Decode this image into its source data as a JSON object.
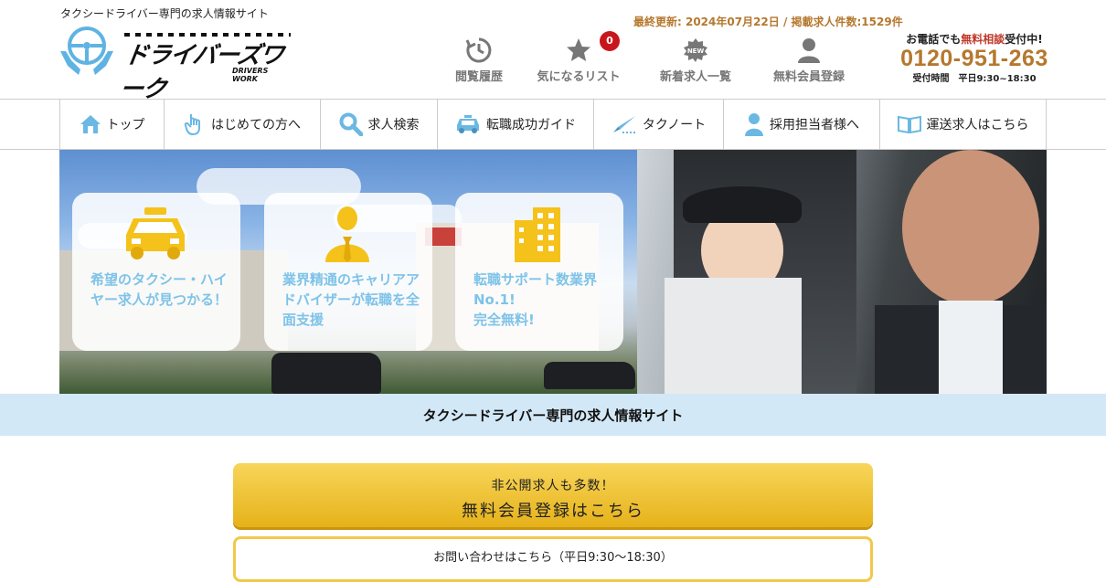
{
  "header": {
    "tagline": "タクシードライバー専門の求人情報サイト",
    "logo_text": "ドライバーズワーク",
    "logo_sub": "DRIVERS WORK",
    "updated": "最終更新: 2024年07月22日 / 掲載求人件数:1529件",
    "nav": [
      {
        "label": "閲覧履歴",
        "icon": "history-icon"
      },
      {
        "label": "気になるリスト",
        "icon": "star-icon",
        "badge": "0"
      },
      {
        "label": "新着求人一覧",
        "icon": "new-badge-icon"
      },
      {
        "label": "無料会員登録",
        "icon": "user-icon"
      }
    ],
    "contact": {
      "prefix": "お電話でも",
      "highlight": "無料相談",
      "suffix": "受付中!",
      "phone": "0120-951-263",
      "hours": "受付時間　平日9:30~18:30"
    }
  },
  "gnav": [
    {
      "label": "トップ",
      "icon": "home-icon"
    },
    {
      "label": "はじめての方へ",
      "icon": "pointer-hand-icon"
    },
    {
      "label": "求人検索",
      "icon": "search-icon"
    },
    {
      "label": "転職成功ガイド",
      "icon": "taxi-icon"
    },
    {
      "label": "タクノート",
      "icon": "pen-icon"
    },
    {
      "label": "採用担当者様へ",
      "icon": "person-icon"
    },
    {
      "label": "運送求人はこちら",
      "icon": "book-icon"
    }
  ],
  "hero": {
    "cards": [
      {
        "text": "希望のタクシー・ハイヤー求人が見つかる！",
        "icon": "taxi-car-icon"
      },
      {
        "text": "業界精通のキャリアアドバイザーが転職を全面支援",
        "icon": "adviser-icon"
      },
      {
        "text": "転職サポート数業界No.1!\n完全無料!",
        "icon": "building-icon"
      }
    ]
  },
  "band": {
    "text": "タクシードライバー専門の求人情報サイト"
  },
  "cta": {
    "sub": "非公開求人も多数！",
    "main": "無料会員登録はこちら"
  },
  "inquiry": {
    "text": "お問い合わせはこちら（平日9:30〜18:30）"
  },
  "colors": {
    "accent_gold": "#b5782e",
    "brand_blue": "#7ec3e8",
    "badge_red": "#c8161d",
    "cta_yellow": "#f1c94a",
    "band_blue": "#d3e8f6"
  }
}
